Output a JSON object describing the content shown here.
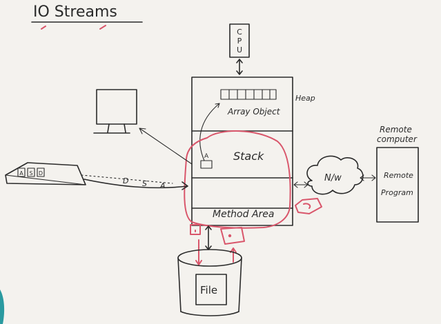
{
  "title": "IO Streams",
  "cpu_letters": [
    "C",
    "P",
    "U"
  ],
  "heap_label": "Heap",
  "array_label": "Array Object",
  "stack_label": "Stack",
  "variable_label": "A",
  "method_area_label": "Method Area",
  "network_label": "N/w",
  "remote_computer_label": [
    "Remote",
    "computer"
  ],
  "remote_program_label": [
    "Remote",
    "Program"
  ],
  "file_label": "File",
  "keyboard_keys": [
    "A",
    "S",
    "D"
  ],
  "keyboard_stream": [
    "D",
    "S",
    "A"
  ],
  "colors": {
    "ink": "#2a2a2a",
    "highlight": "#d9566b",
    "board": "#f4f2ee"
  }
}
